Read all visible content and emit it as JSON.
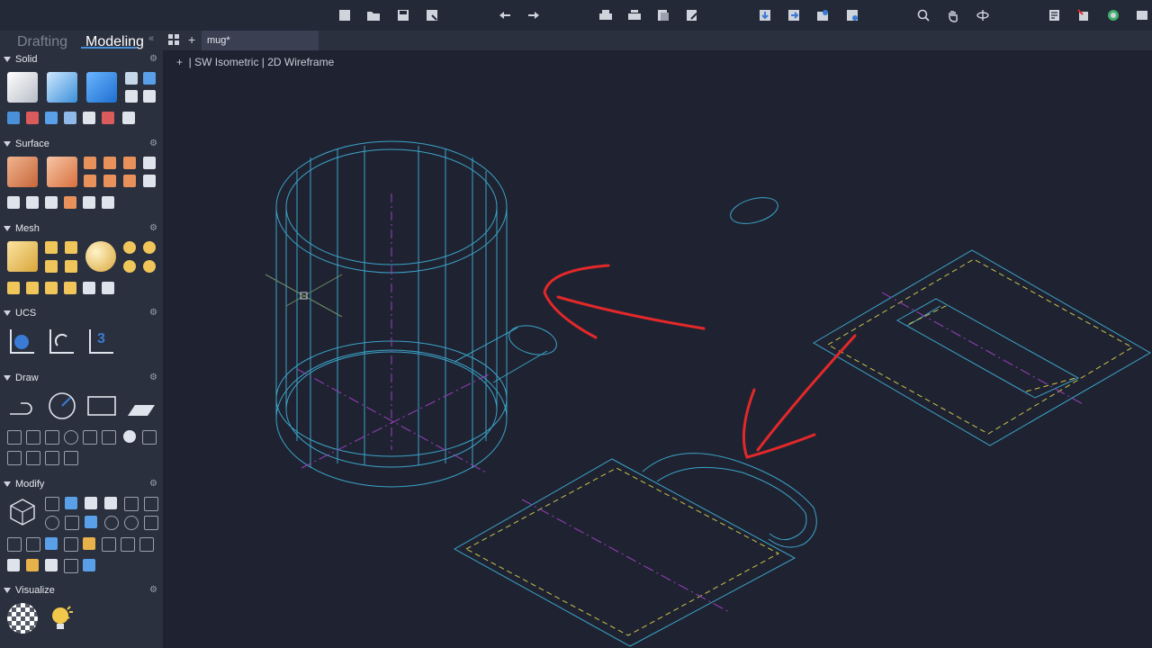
{
  "sidebar": {
    "tabs": [
      {
        "label": "Drafting",
        "active": false
      },
      {
        "label": "Modeling",
        "active": true
      }
    ],
    "collapse_glyph": "«",
    "panels": [
      {
        "id": "solid",
        "title": "Solid"
      },
      {
        "id": "surface",
        "title": "Surface"
      },
      {
        "id": "mesh",
        "title": "Mesh"
      },
      {
        "id": "ucs",
        "title": "UCS"
      },
      {
        "id": "draw",
        "title": "Draw"
      },
      {
        "id": "modify",
        "title": "Modify"
      },
      {
        "id": "visualize",
        "title": "Visualize"
      }
    ],
    "gear_glyph": "⚙"
  },
  "document_tabs": {
    "new_tab_glyph": "+",
    "active_tab_label": "mug*"
  },
  "viewport": {
    "label": "+  | SW Isometric | 2D Wireframe"
  },
  "ucs_icon_label": "3",
  "colors": {
    "background": "#1f2331",
    "panel": "#2b303e",
    "geometry_cyan": "#3ba3c9",
    "centerline_magenta": "#9b3fc0",
    "hidden_yellow": "#c9c24a",
    "annotation_red": "#e3282a"
  }
}
